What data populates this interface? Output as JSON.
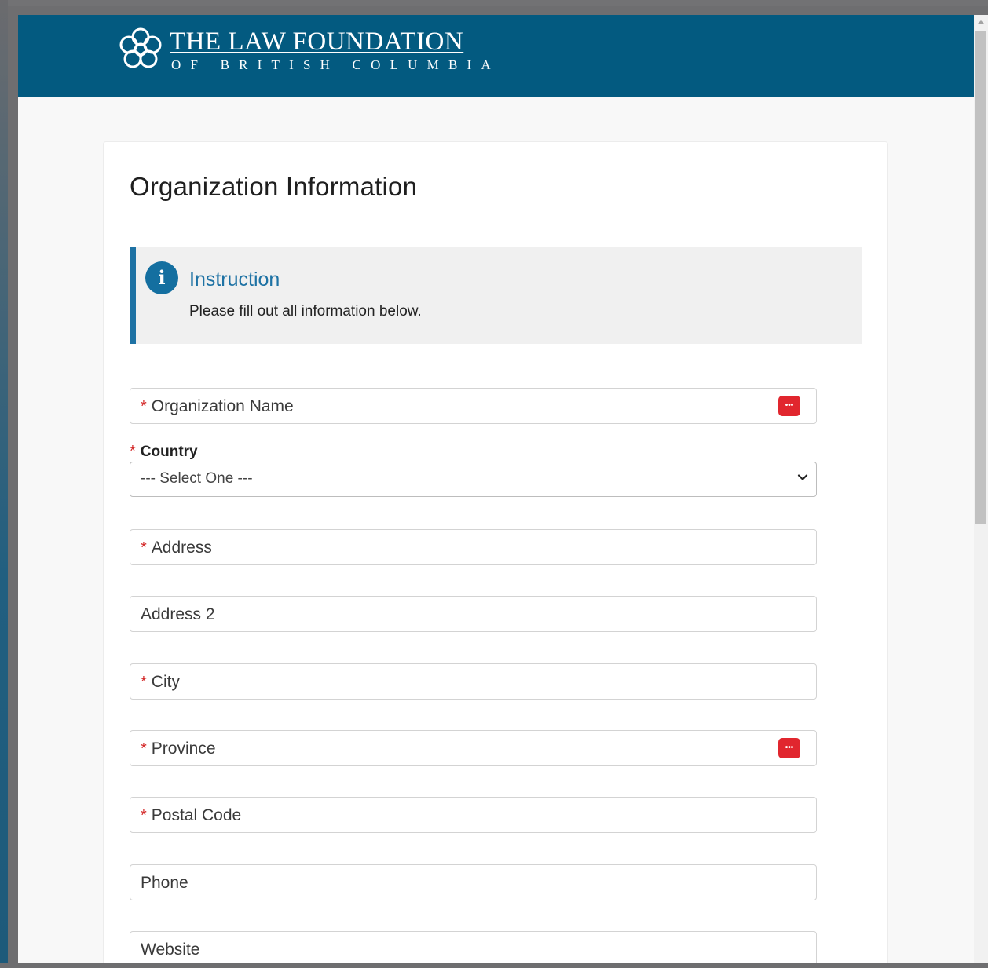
{
  "header": {
    "logo_line1": "THE LAW FOUNDATION",
    "logo_line2": "OF BRITISH COLUMBIA",
    "background": "#035a80"
  },
  "page": {
    "title": "Organization Information"
  },
  "instruction": {
    "title": "Instruction",
    "body": "Please fill out all information below.",
    "icon": "info-icon",
    "accent": "#1e72a4"
  },
  "form": {
    "required_marker": "*",
    "organization_name": {
      "label": "Organization Name",
      "required": true
    },
    "country": {
      "label": "Country",
      "selected": "--- Select One ---",
      "required": true
    },
    "address": {
      "label": "Address",
      "required": true
    },
    "address2": {
      "label": "Address 2",
      "required": false
    },
    "city": {
      "label": "City",
      "required": true
    },
    "province": {
      "label": "Province",
      "required": true
    },
    "postal_code": {
      "label": "Postal Code",
      "required": true
    },
    "phone": {
      "label": "Phone",
      "required": false
    },
    "website": {
      "label": "Website",
      "required": false
    },
    "picker_icon": "ellipsis-icon",
    "picker_color": "#e1262e"
  }
}
